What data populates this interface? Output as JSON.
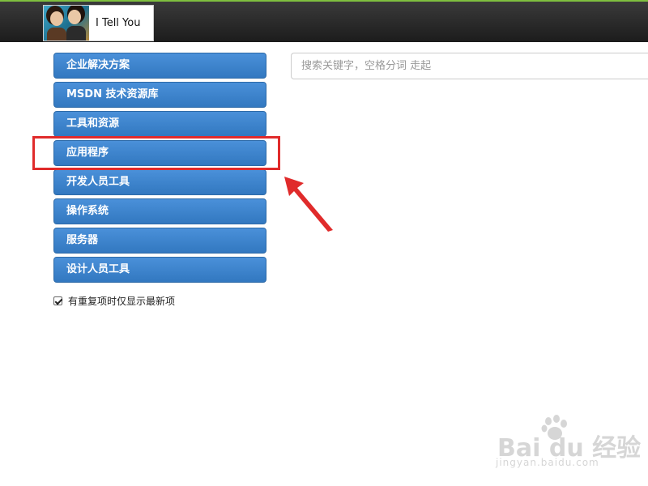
{
  "header": {
    "logo_text": "I Tell You"
  },
  "search": {
    "placeholder": "搜索关键字，空格分词 走起"
  },
  "sidebar": {
    "items": [
      {
        "label": "企业解决方案"
      },
      {
        "label": "MSDN 技术资源库"
      },
      {
        "label": "工具和资源"
      },
      {
        "label": "应用程序"
      },
      {
        "label": "开发人员工具"
      },
      {
        "label": "操作系统"
      },
      {
        "label": "服务器"
      },
      {
        "label": "设计人员工具"
      }
    ],
    "checkbox": {
      "label": "有重复项时仅显示最新项",
      "checked": true
    }
  },
  "annotation": {
    "highlighted_item": "应用程序",
    "color": "#e02b2b"
  },
  "watermark": {
    "main": "Bai du 经验",
    "sub": "jingyan.baidu.com"
  },
  "colors": {
    "nav_button": "#3a83cc",
    "header_bg": "#262626",
    "accent_line": "#7fbf3f"
  }
}
